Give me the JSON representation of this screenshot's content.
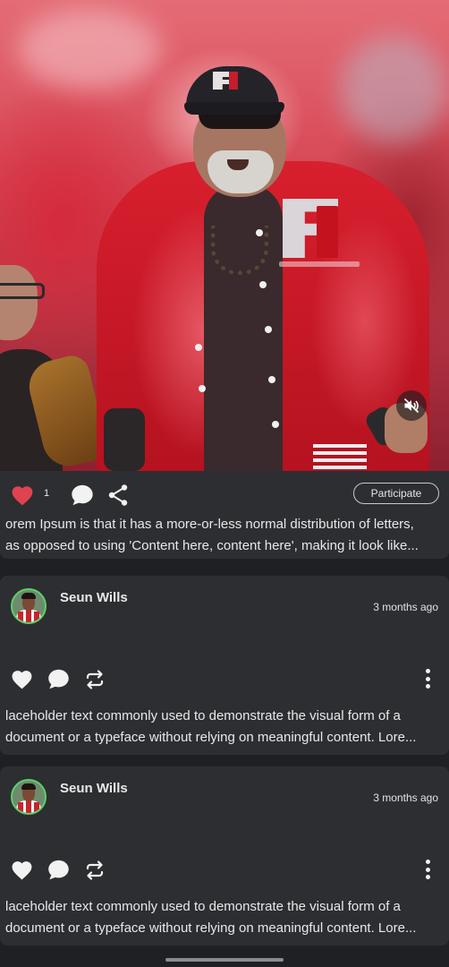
{
  "video": {
    "mute_icon": "volume-muted-icon"
  },
  "post": {
    "like_count": "1",
    "participate_label": "Participate",
    "description_lines": [
      "orem Ipsum is that it has a more-or-less normal distribution of letters,",
      "as opposed to using 'Content here, content here', making it look like..."
    ],
    "accent_color": "#e0434f"
  },
  "comments": [
    {
      "username": "Seun Wills",
      "time": "3 months ago",
      "lines": [
        "laceholder text commonly used to demonstrate the visual form of a",
        "document or a typeface without relying on meaningful content. Lore..."
      ]
    },
    {
      "username": "Seun Wills",
      "time": "3 months ago",
      "lines": [
        "laceholder text commonly used to demonstrate the visual form of a",
        "document or a typeface without relying on meaningful content. Lore..."
      ]
    }
  ]
}
